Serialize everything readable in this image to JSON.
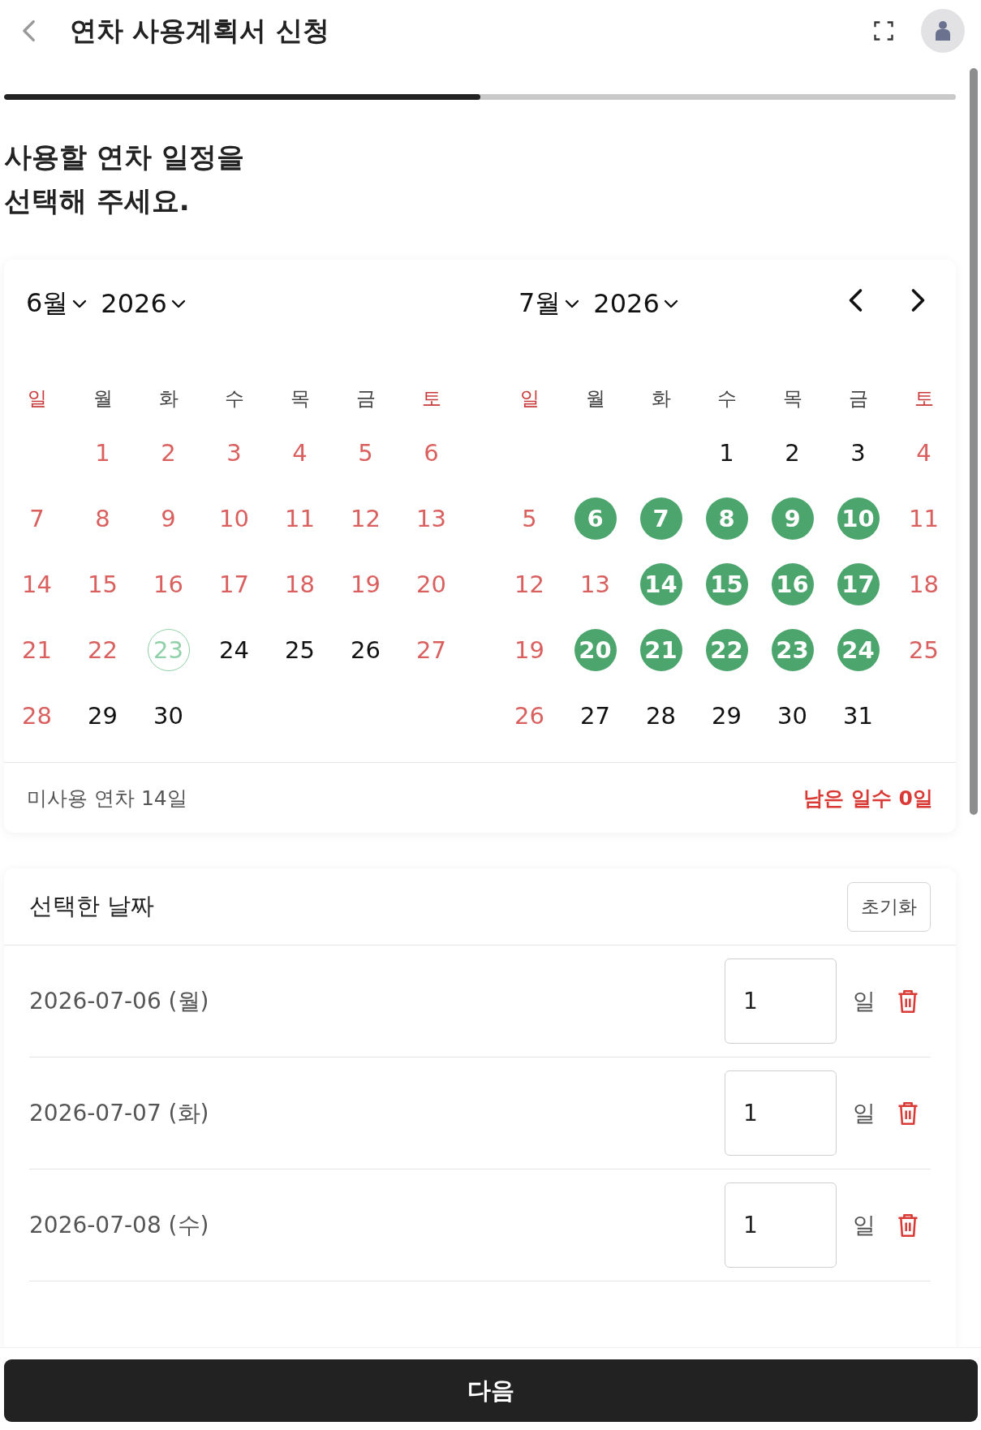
{
  "header": {
    "title": "연차 사용계획서 신청"
  },
  "progress": {
    "level": 0.5
  },
  "heading": "사용할 연차 일정을\n선택해 주세요.",
  "calendar": {
    "months": [
      {
        "month": "6월",
        "year": "2026",
        "weekdays": [
          {
            "label": "일",
            "weekend": true
          },
          {
            "label": "월",
            "weekend": false
          },
          {
            "label": "화",
            "weekend": false
          },
          {
            "label": "수",
            "weekend": false
          },
          {
            "label": "목",
            "weekend": false
          },
          {
            "label": "금",
            "weekend": false
          },
          {
            "label": "토",
            "weekend": true
          }
        ],
        "weeks": [
          [
            {
              "kind": "blank"
            },
            {
              "label": "1",
              "kind": "holiday",
              "selected": false
            },
            {
              "label": "2",
              "kind": "holiday",
              "selected": false
            },
            {
              "label": "3",
              "kind": "holiday",
              "selected": false
            },
            {
              "label": "4",
              "kind": "holiday",
              "selected": false
            },
            {
              "label": "5",
              "kind": "holiday",
              "selected": false
            },
            {
              "label": "6",
              "kind": "holiday",
              "selected": false
            }
          ],
          [
            {
              "label": "7",
              "kind": "holiday",
              "selected": false
            },
            {
              "label": "8",
              "kind": "holiday",
              "selected": false
            },
            {
              "label": "9",
              "kind": "holiday",
              "selected": false
            },
            {
              "label": "10",
              "kind": "holiday",
              "selected": false
            },
            {
              "label": "11",
              "kind": "holiday",
              "selected": false
            },
            {
              "label": "12",
              "kind": "holiday",
              "selected": false
            },
            {
              "label": "13",
              "kind": "holiday",
              "selected": false
            }
          ],
          [
            {
              "label": "14",
              "kind": "holiday",
              "selected": false
            },
            {
              "label": "15",
              "kind": "holiday",
              "selected": false
            },
            {
              "label": "16",
              "kind": "holiday",
              "selected": false
            },
            {
              "label": "17",
              "kind": "holiday",
              "selected": false
            },
            {
              "label": "18",
              "kind": "holiday",
              "selected": false
            },
            {
              "label": "19",
              "kind": "holiday",
              "selected": false
            },
            {
              "label": "20",
              "kind": "holiday",
              "selected": false
            }
          ],
          [
            {
              "label": "21",
              "kind": "holiday",
              "selected": false
            },
            {
              "label": "22",
              "kind": "holiday",
              "selected": false
            },
            {
              "label": "23",
              "kind": "today",
              "selected": false
            },
            {
              "label": "24",
              "kind": "normal",
              "selected": false
            },
            {
              "label": "25",
              "kind": "normal",
              "selected": false
            },
            {
              "label": "26",
              "kind": "normal",
              "selected": false
            },
            {
              "label": "27",
              "kind": "holiday",
              "selected": false
            }
          ],
          [
            {
              "label": "28",
              "kind": "holiday",
              "selected": false
            },
            {
              "label": "29",
              "kind": "normal",
              "selected": false
            },
            {
              "label": "30",
              "kind": "normal",
              "selected": false
            },
            {
              "kind": "blank"
            },
            {
              "kind": "blank"
            },
            {
              "kind": "blank"
            },
            {
              "kind": "blank"
            }
          ]
        ]
      },
      {
        "month": "7월",
        "year": "2026",
        "weekdays": [
          {
            "label": "일",
            "weekend": true
          },
          {
            "label": "월",
            "weekend": false
          },
          {
            "label": "화",
            "weekend": false
          },
          {
            "label": "수",
            "weekend": false
          },
          {
            "label": "목",
            "weekend": false
          },
          {
            "label": "금",
            "weekend": false
          },
          {
            "label": "토",
            "weekend": true
          }
        ],
        "weeks": [
          [
            {
              "kind": "blank"
            },
            {
              "kind": "blank"
            },
            {
              "kind": "blank"
            },
            {
              "label": "1",
              "kind": "normal",
              "selected": false
            },
            {
              "label": "2",
              "kind": "normal",
              "selected": false
            },
            {
              "label": "3",
              "kind": "normal",
              "selected": false
            },
            {
              "label": "4",
              "kind": "holiday",
              "selected": false
            }
          ],
          [
            {
              "label": "5",
              "kind": "holiday",
              "selected": false
            },
            {
              "label": "6",
              "kind": "normal",
              "selected": true
            },
            {
              "label": "7",
              "kind": "normal",
              "selected": true
            },
            {
              "label": "8",
              "kind": "normal",
              "selected": true
            },
            {
              "label": "9",
              "kind": "normal",
              "selected": true
            },
            {
              "label": "10",
              "kind": "normal",
              "selected": true
            },
            {
              "label": "11",
              "kind": "holiday",
              "selected": false
            }
          ],
          [
            {
              "label": "12",
              "kind": "holiday",
              "selected": false
            },
            {
              "label": "13",
              "kind": "holiday",
              "selected": false
            },
            {
              "label": "14",
              "kind": "normal",
              "selected": true
            },
            {
              "label": "15",
              "kind": "normal",
              "selected": true
            },
            {
              "label": "16",
              "kind": "normal",
              "selected": true
            },
            {
              "label": "17",
              "kind": "normal",
              "selected": true
            },
            {
              "label": "18",
              "kind": "holiday",
              "selected": false
            }
          ],
          [
            {
              "label": "19",
              "kind": "holiday",
              "selected": false
            },
            {
              "label": "20",
              "kind": "normal",
              "selected": true
            },
            {
              "label": "21",
              "kind": "normal",
              "selected": true
            },
            {
              "label": "22",
              "kind": "normal",
              "selected": true
            },
            {
              "label": "23",
              "kind": "normal",
              "selected": true
            },
            {
              "label": "24",
              "kind": "normal",
              "selected": true
            },
            {
              "label": "25",
              "kind": "holiday",
              "selected": false
            }
          ],
          [
            {
              "label": "26",
              "kind": "holiday",
              "selected": false
            },
            {
              "label": "27",
              "kind": "normal",
              "selected": false
            },
            {
              "label": "28",
              "kind": "normal",
              "selected": false
            },
            {
              "label": "29",
              "kind": "normal",
              "selected": false
            },
            {
              "label": "30",
              "kind": "normal",
              "selected": false
            },
            {
              "label": "31",
              "kind": "normal",
              "selected": false
            },
            {
              "kind": "blank"
            }
          ]
        ]
      }
    ],
    "unused": "미사용 연차 14일",
    "remaining": "남은 일수 0일"
  },
  "selected_dates": {
    "title": "선택한 날짜",
    "reset_button": "초기화",
    "rows": [
      {
        "date": "2026-07-06 (월)",
        "days": "1",
        "unit": "일"
      },
      {
        "date": "2026-07-07 (화)",
        "days": "1",
        "unit": "일"
      },
      {
        "date": "2026-07-08 (수)",
        "days": "1",
        "unit": "일"
      }
    ]
  },
  "next_button": "다음"
}
